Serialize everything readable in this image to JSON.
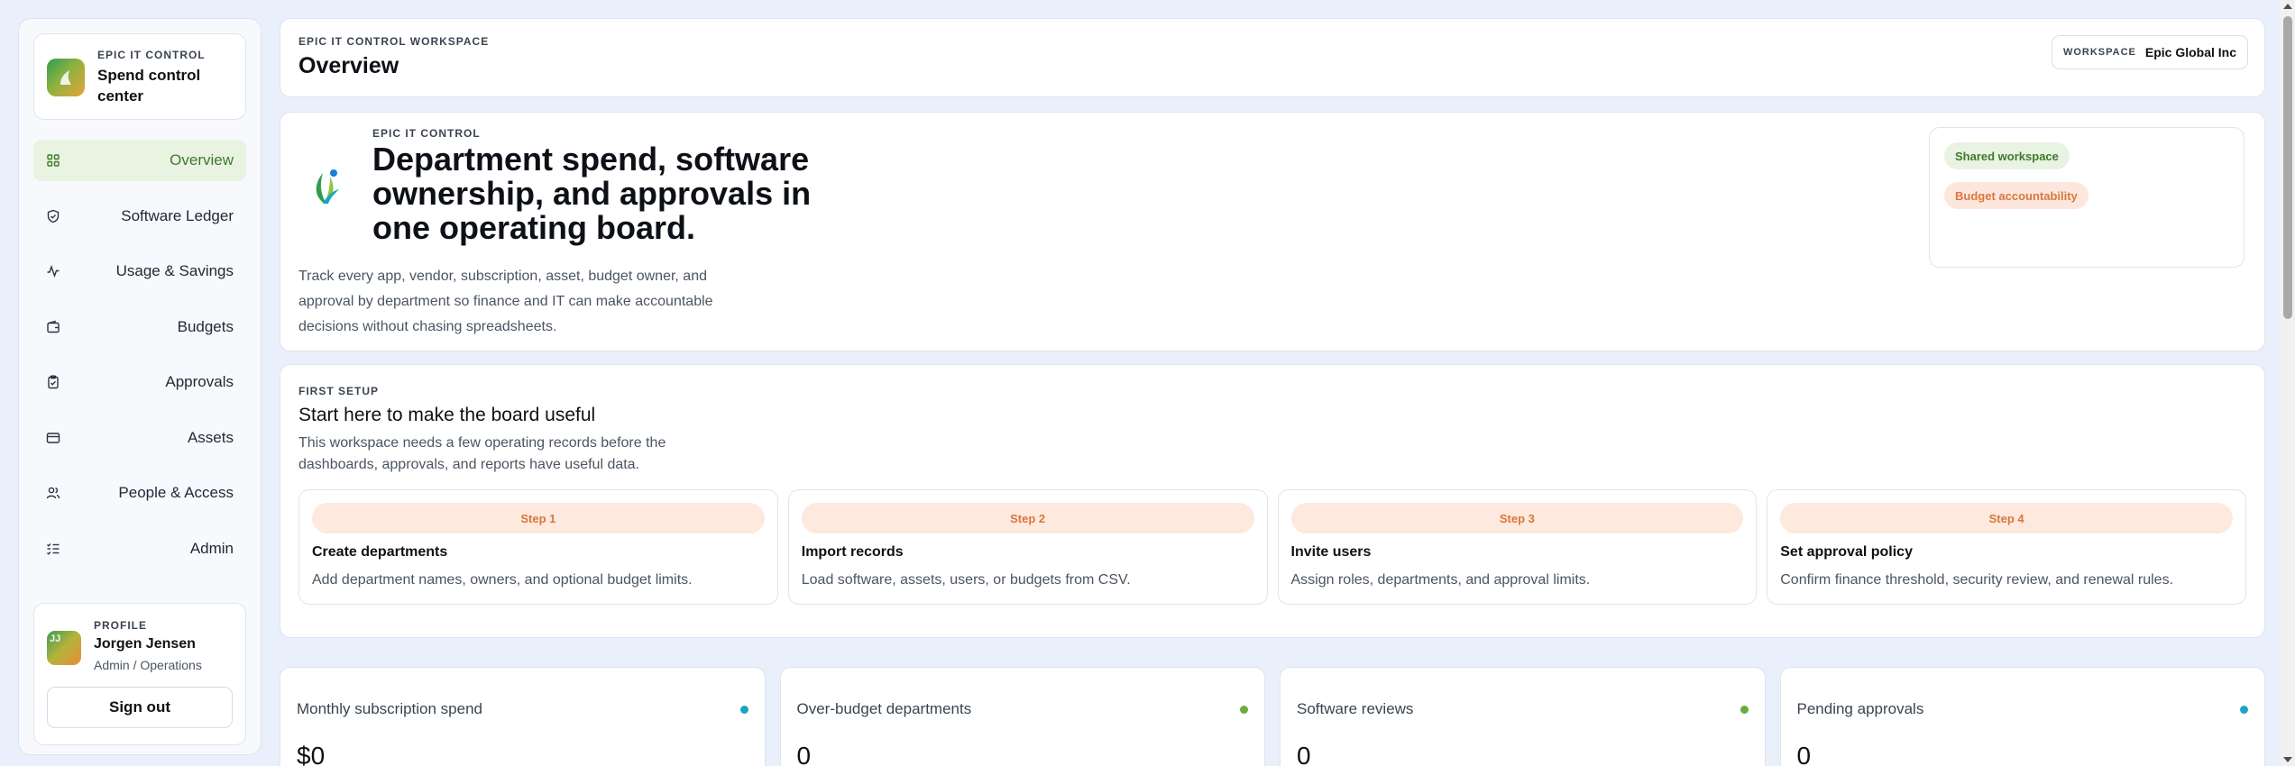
{
  "brand": {
    "kicker": "EPIC IT CONTROL",
    "title": "Spend control center"
  },
  "nav": {
    "items": [
      {
        "label": "Overview",
        "icon": "grid-icon",
        "active": true
      },
      {
        "label": "Software Ledger",
        "icon": "shield-icon"
      },
      {
        "label": "Usage & Savings",
        "icon": "activity-icon"
      },
      {
        "label": "Budgets",
        "icon": "wallet-icon"
      },
      {
        "label": "Approvals",
        "icon": "clipboard-check-icon"
      },
      {
        "label": "Assets",
        "icon": "card-icon"
      },
      {
        "label": "People & Access",
        "icon": "users-icon"
      },
      {
        "label": "Admin",
        "icon": "list-check-icon"
      }
    ]
  },
  "profile": {
    "kicker": "PROFILE",
    "initials": "JJ",
    "name": "Jorgen Jensen",
    "role": "Admin / Operations",
    "signout_label": "Sign out"
  },
  "header": {
    "kicker": "EPIC IT CONTROL WORKSPACE",
    "title": "Overview",
    "workspace_label": "WORKSPACE",
    "workspace_value": "Epic Global Inc"
  },
  "hero": {
    "kicker": "EPIC IT CONTROL",
    "title": "Department spend, software ownership, and approvals in one operating board.",
    "description": "Track every app, vendor, subscription, asset, budget owner, and approval by department so finance and IT can make accountable decisions without chasing spreadsheets.",
    "tags": [
      "Shared workspace",
      "Budget accountability"
    ]
  },
  "setup": {
    "kicker": "FIRST SETUP",
    "title": "Start here to make the board useful",
    "description": "This workspace needs a few operating records before the dashboards, approvals, and reports have useful data.",
    "steps": [
      {
        "pill": "Step 1",
        "title": "Create departments",
        "description": "Add department names, owners, and optional budget limits."
      },
      {
        "pill": "Step 2",
        "title": "Import records",
        "description": "Load software, assets, users, or budgets from CSV."
      },
      {
        "pill": "Step 3",
        "title": "Invite users",
        "description": "Assign roles, departments, and approval limits."
      },
      {
        "pill": "Step 4",
        "title": "Set approval policy",
        "description": "Confirm finance threshold, security review, and renewal rules."
      }
    ]
  },
  "stats": [
    {
      "label": "Monthly subscription spend",
      "value": "$0",
      "dot_color": "#1aa5c4"
    },
    {
      "label": "Over-budget departments",
      "value": "0",
      "dot_color": "#6aab3e"
    },
    {
      "label": "Software reviews",
      "value": "0",
      "dot_color": "#6aab3e"
    },
    {
      "label": "Pending approvals",
      "value": "0",
      "dot_color": "#1aa5c4"
    }
  ],
  "colors": {
    "accent_green": "#3f7a2c",
    "accent_orange": "#d9773f",
    "background": "#eaf0fb"
  }
}
